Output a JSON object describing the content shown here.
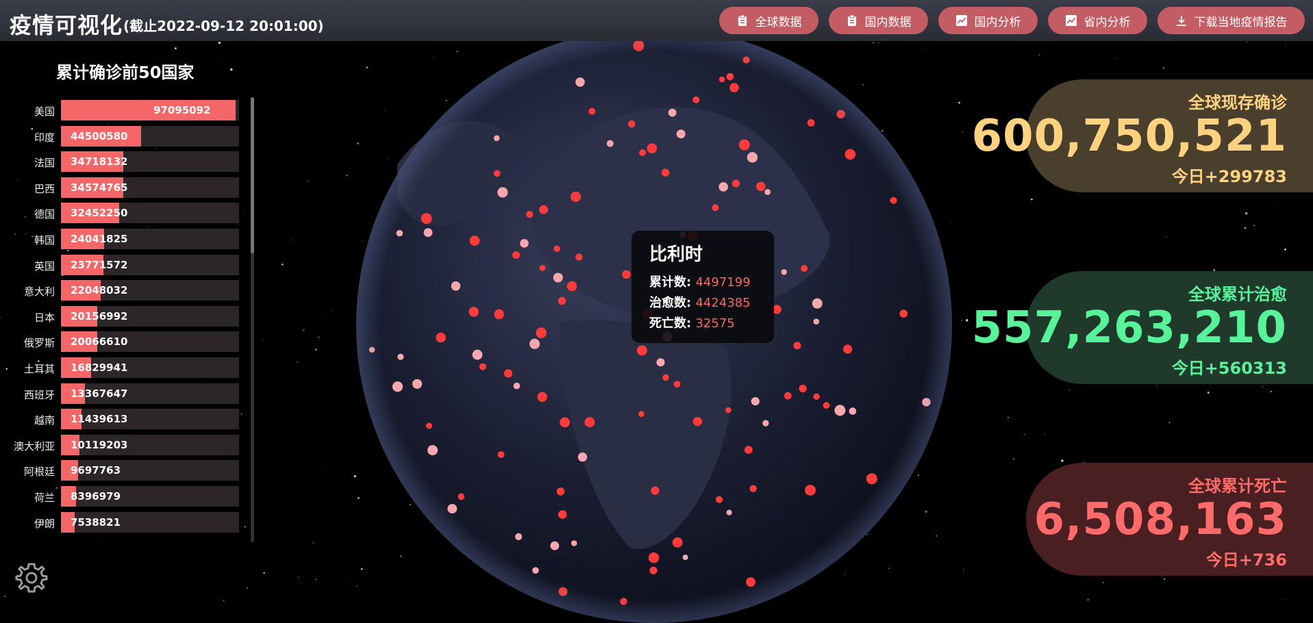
{
  "header": {
    "title": "疫情可视化",
    "subtitle": "(截止2022-09-12 20:01:00)",
    "nav": [
      {
        "label": "全球数据",
        "icon": "clipboard-icon"
      },
      {
        "label": "国内数据",
        "icon": "clipboard-icon"
      },
      {
        "label": "国内分析",
        "icon": "line-chart-icon"
      },
      {
        "label": "省内分析",
        "icon": "line-chart-icon"
      },
      {
        "label": "下载当地疫情报告",
        "icon": "download-icon"
      }
    ]
  },
  "ranking": {
    "title": "累计确诊前50国家",
    "items": [
      {
        "name": "美国",
        "value": 97095092
      },
      {
        "name": "印度",
        "value": 44500580
      },
      {
        "name": "法国",
        "value": 34718132
      },
      {
        "name": "巴西",
        "value": 34574765
      },
      {
        "name": "德国",
        "value": 32452250
      },
      {
        "name": "韩国",
        "value": 24041825
      },
      {
        "name": "英国",
        "value": 23771572
      },
      {
        "name": "意大利",
        "value": 22048032
      },
      {
        "name": "日本",
        "value": 20156992
      },
      {
        "name": "俄罗斯",
        "value": 20066610
      },
      {
        "name": "土耳其",
        "value": 16829941
      },
      {
        "name": "西班牙",
        "value": 13367647
      },
      {
        "name": "越南",
        "value": 11439613
      },
      {
        "name": "澳大利亚",
        "value": 10119203
      },
      {
        "name": "阿根廷",
        "value": 9697763
      },
      {
        "name": "荷兰",
        "value": 8396979
      },
      {
        "name": "伊朗",
        "value": 7538821
      }
    ]
  },
  "tooltip": {
    "name": "比利时",
    "confirmed_label": "累计数:",
    "confirmed": "4497199",
    "cured_label": "治愈数:",
    "cured": "4424385",
    "dead_label": "死亡数:",
    "dead": "32575"
  },
  "stats": {
    "current": {
      "label": "全球现存确诊",
      "value": "600,750,521",
      "today": "今日+299783"
    },
    "cured": {
      "label": "全球累计治愈",
      "value": "557,263,210",
      "today": "今日+560313"
    },
    "dead": {
      "label": "全球累计死亡",
      "value": "6,508,163",
      "today": "今日+736"
    }
  },
  "colors": {
    "nav_button": "#c35c63",
    "bar": "#f46667",
    "current_text": "#ffd27f",
    "current_bg": "#4a3f2c",
    "cured_text": "#58f29a",
    "cured_bg": "#1f3a2a",
    "dead_text": "#ff6b6b",
    "dead_bg": "#4a1f22"
  }
}
